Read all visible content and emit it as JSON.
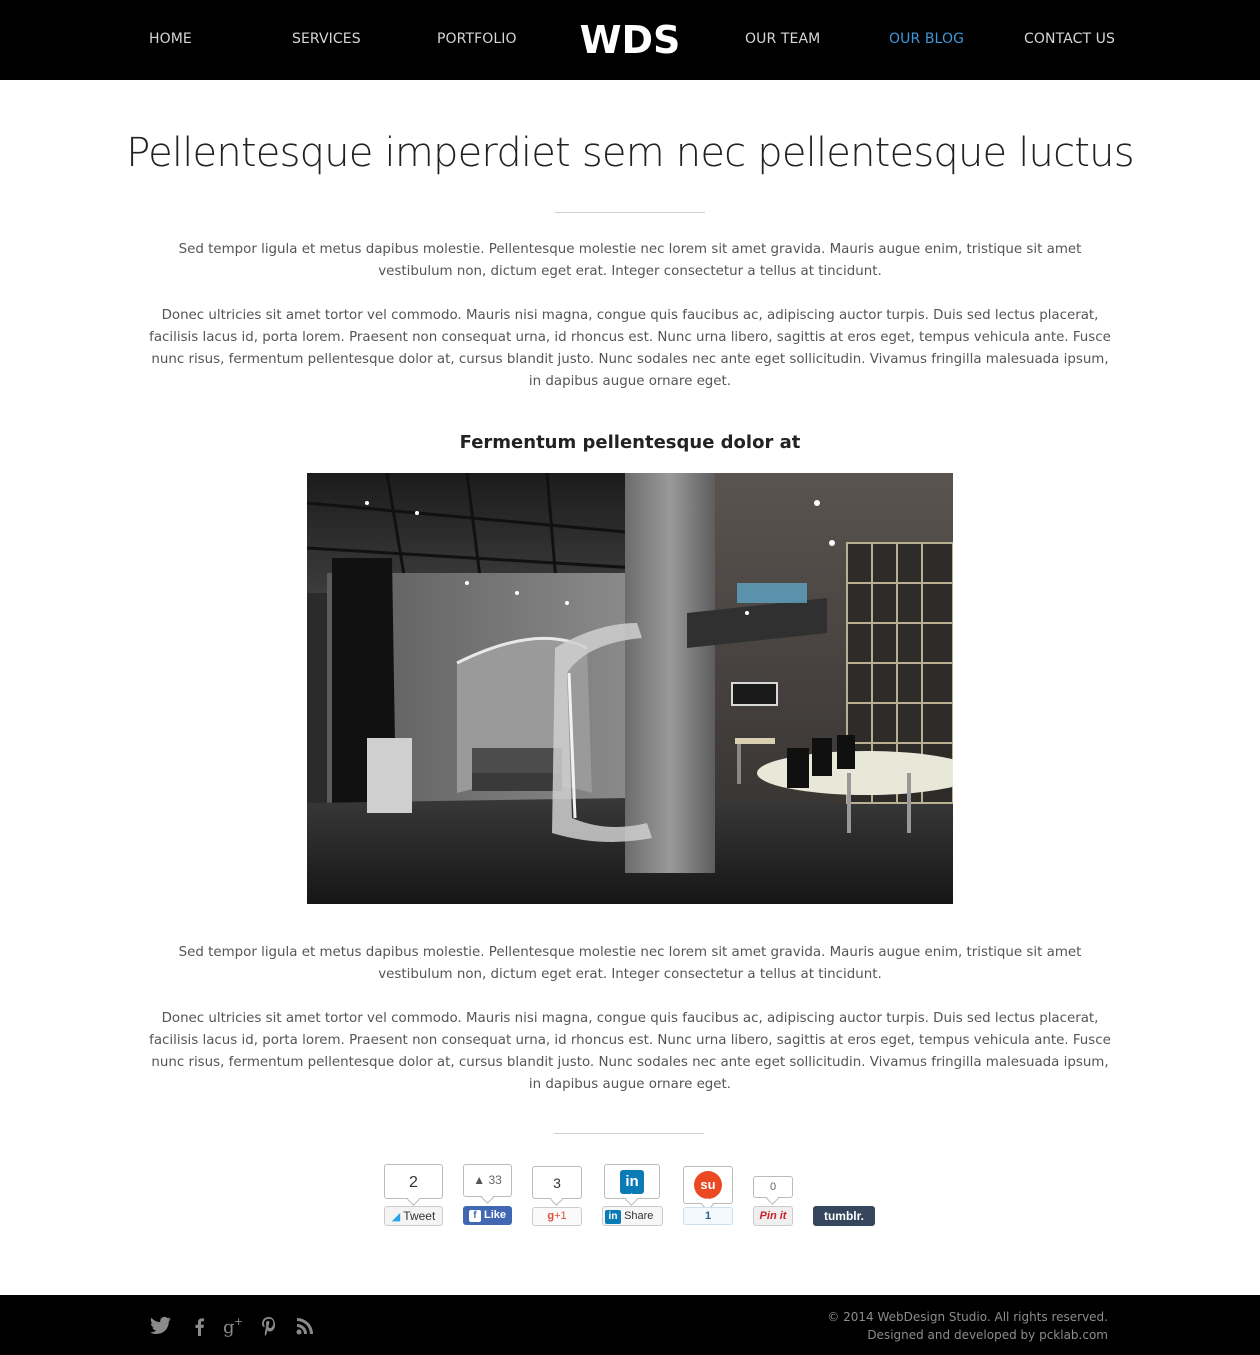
{
  "nav": {
    "home": "HOME",
    "services": "SERVICES",
    "portfolio": "PORTFOLIO",
    "logo": "WDS",
    "team": "OUR TEAM",
    "blog": "OUR BLOG",
    "contact": "CONTACT US",
    "active_color": "#3c97dc"
  },
  "article": {
    "title": "Pellentesque imperdiet sem nec pellentesque luctus",
    "p1": "Sed tempor ligula et metus dapibus molestie. Pellentesque molestie nec lorem sit amet gravida. Mauris augue enim, tristique sit amet vestibulum non, dictum eget erat. Integer consectetur a tellus at tincidunt.",
    "p2": "Donec ultricies sit amet tortor vel commodo. Mauris nisi magna, congue quis faucibus ac, adipiscing auctor turpis. Duis sed lectus placerat, facilisis lacus id, porta lorem. Praesent non consequat urna, id rhoncus est. Nunc urna libero, sagittis at eros eget, tempus vehicula ante. Fusce nunc risus, fermentum pellentesque dolor at, cursus blandit justo. Nunc sodales nec ante eget sollicitudin. Vivamus fringilla malesuada ipsum, in dapibus augue ornare eget.",
    "subheading": "Fermentum pellentesque dolor at",
    "p3": "Sed tempor ligula et metus dapibus molestie. Pellentesque molestie nec lorem sit amet gravida. Mauris augue enim, tristique sit amet vestibulum non, dictum eget erat. Integer consectetur a tellus at tincidunt.",
    "p4": "Donec ultricies sit amet tortor vel commodo. Mauris nisi magna, congue quis faucibus ac, adipiscing auctor turpis. Duis sed lectus placerat, facilisis lacus id, porta lorem. Praesent non consequat urna, id rhoncus est. Nunc urna libero, sagittis at eros eget, tempus vehicula ante. Fusce nunc risus, fermentum pellentesque dolor at, cursus blandit justo. Nunc sodales nec ante eget sollicitudin. Vivamus fringilla malesuada ipsum, in dapibus augue ornare eget."
  },
  "share": {
    "tweet_count": "2",
    "tweet_label": "Tweet",
    "like_count": "33",
    "like_label": "Like",
    "gplus_count": "3",
    "gplus_label": "+1",
    "linkedin_logo": "in",
    "linkedin_label": "Share",
    "stumble_count": "1",
    "pin_count": "0",
    "pin_label": "Pin it",
    "tumblr_label": "tumblr.",
    "icons": [
      "twitter-bird-icon",
      "facebook-f-icon",
      "google-plus-icon",
      "linkedin-icon",
      "stumbleupon-icon",
      "pinterest-icon",
      "tumblr-icon"
    ]
  },
  "footer": {
    "social_icons": [
      "twitter-icon",
      "facebook-icon",
      "google-plus-icon",
      "pinterest-icon",
      "rss-icon"
    ],
    "copyright": "© 2014 WebDesign Studio. All rights reserved.",
    "credits": "Designed and developed by pcklab.com"
  }
}
